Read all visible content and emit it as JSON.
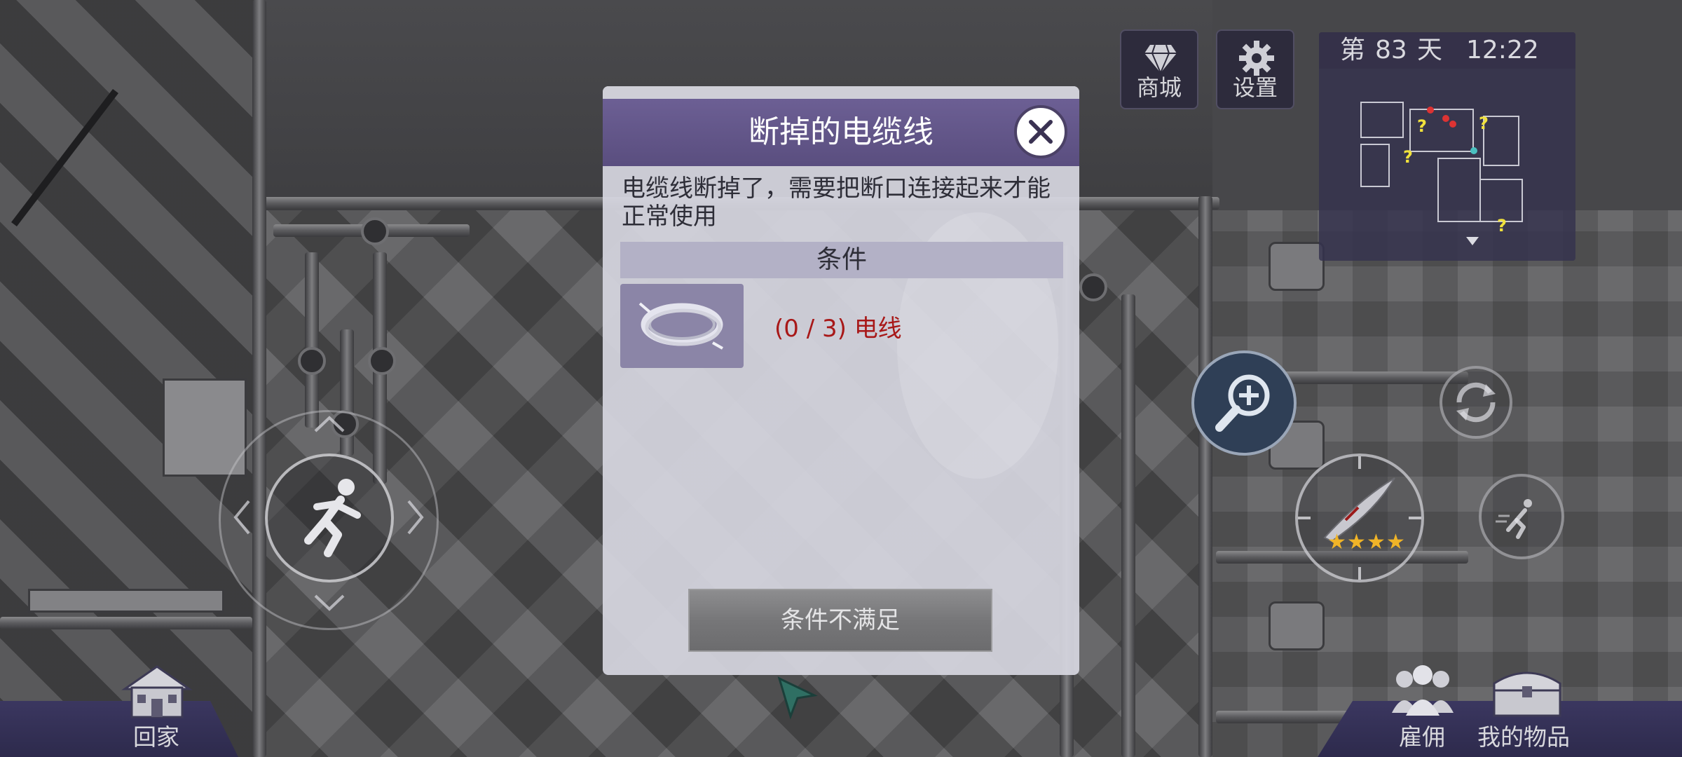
{
  "hud": {
    "shop_label": "商城",
    "settings_label": "设置",
    "day_prefix": "第",
    "day_number": "83",
    "day_suffix": "天",
    "time": "12:22",
    "map_markers": [
      "?",
      "?",
      "?",
      "?"
    ]
  },
  "dialog": {
    "title": "断掉的电缆线",
    "description": "电缆线断掉了，需要把断口连接起来才能正常使用",
    "conditions_header": "条件",
    "requirement": {
      "item_icon": "cable-coil-icon",
      "progress": "(0 / 3)",
      "item_name": "电线",
      "current": 0,
      "required": 3
    },
    "action_label": "条件不满足"
  },
  "bottom": {
    "home_label": "回家",
    "hire_label": "雇佣",
    "items_label": "我的物品"
  },
  "weapon": {
    "stars": 4
  },
  "colors": {
    "dialog_header": "#5a4e7f",
    "requirement_text": "#a81818",
    "map_marker": "#f1e23c"
  }
}
